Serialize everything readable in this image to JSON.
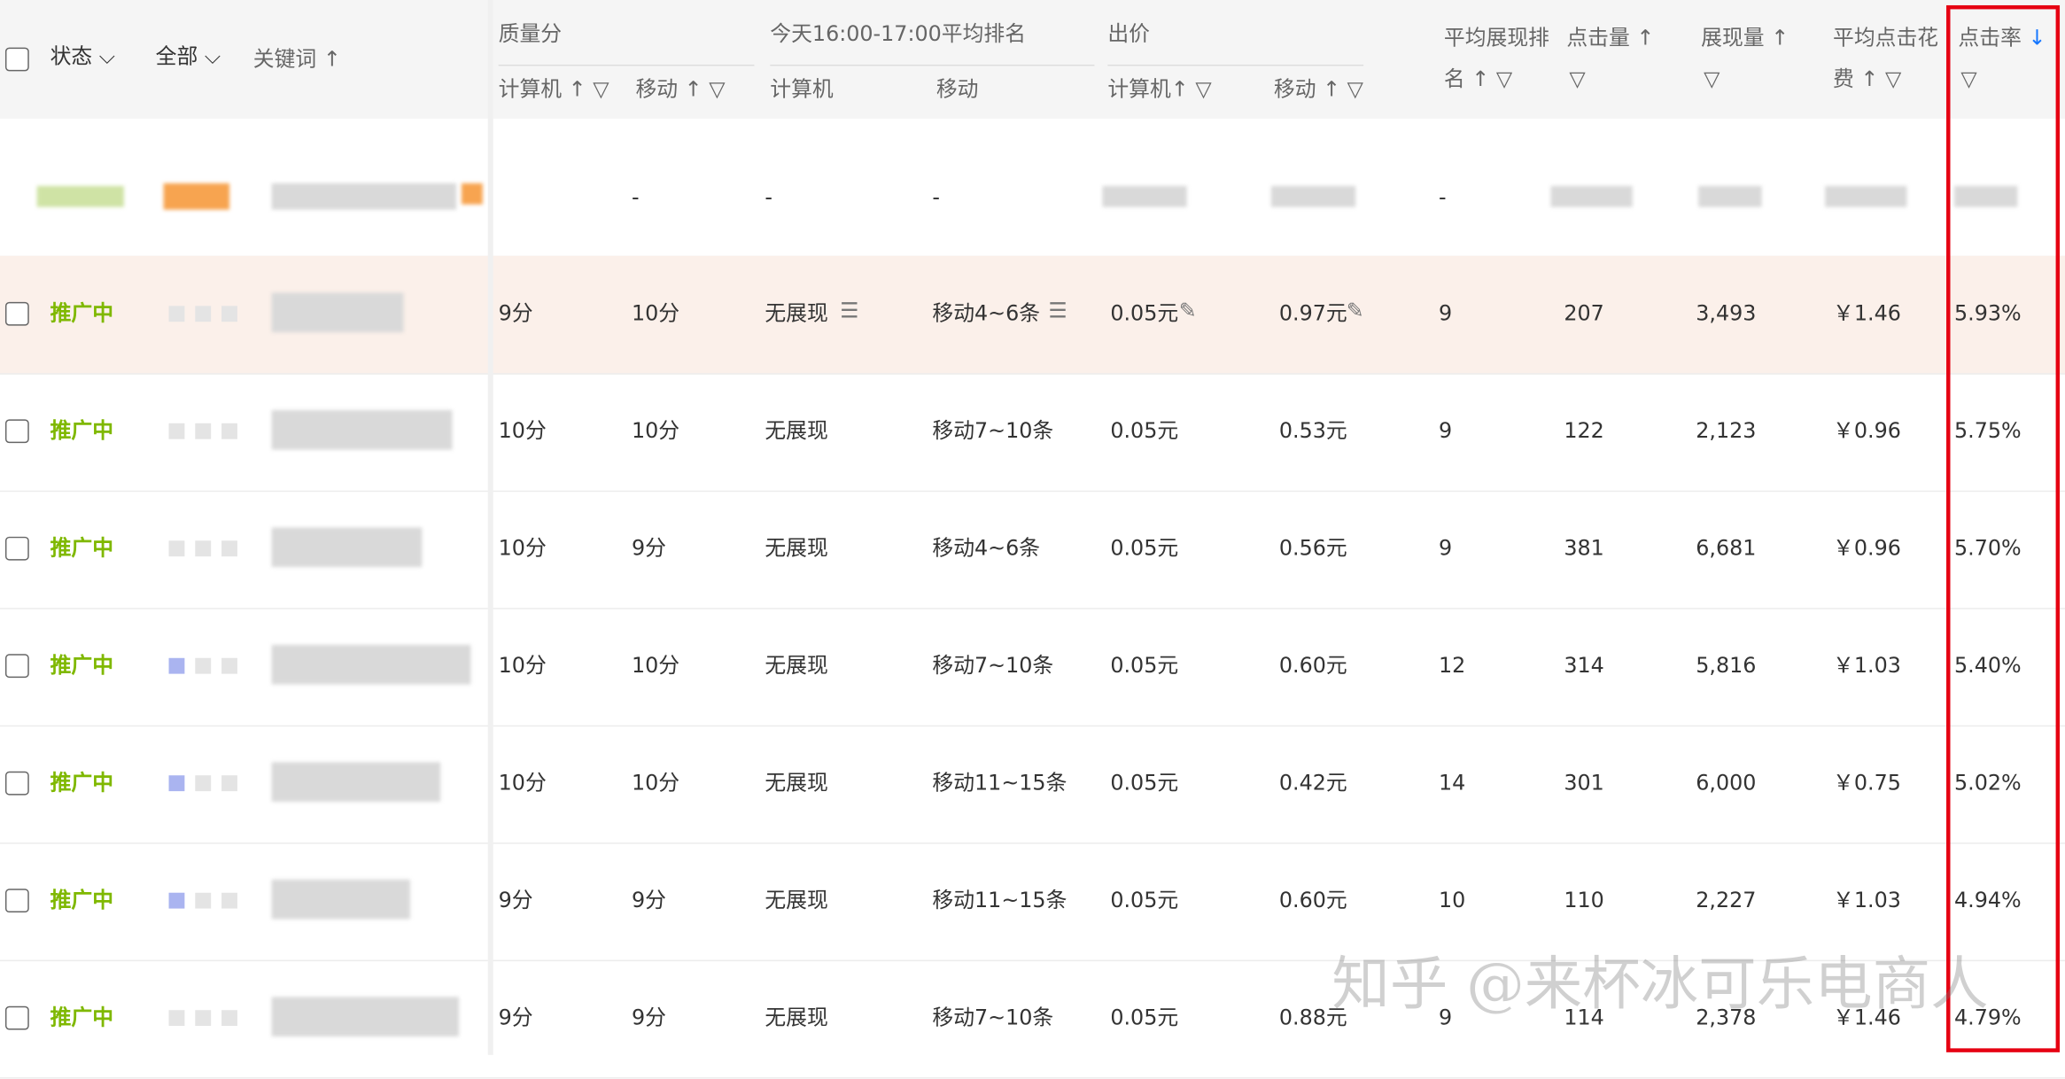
{
  "header": {
    "status": "状态",
    "all": "全部",
    "keyword": "关键词 ↑",
    "quality": "质量分",
    "quality_pc": "计算机 ↑",
    "quality_mobile": "移动 ↑",
    "ranking": "今天16:00-17:00平均排名",
    "ranking_pc": "计算机",
    "ranking_mobile": "移动",
    "bid": "出价",
    "bid_pc": "计算机↑",
    "bid_mobile": "移动 ↑",
    "avg_rank_1": "平均展现排",
    "avg_rank_2": "名 ↑",
    "clicks": "点击量 ↑",
    "impressions": "展现量 ↑",
    "avg_cost_1": "平均点击花",
    "avg_cost_2": "费 ↑",
    "ctr": "点击率",
    "ctr_sort": "↓"
  },
  "summary": {
    "q_pc": "-",
    "q_mobile": "-",
    "rank_pc": "-",
    "avg_rank": "-"
  },
  "rows": [
    {
      "status": "推广中",
      "q_pc": "9分",
      "q_mobile": "10分",
      "rank_pc": "无展现",
      "rank_mobile": "移动4~6条",
      "bid_pc": "0.05元",
      "bid_mobile": "0.97元",
      "avg_rank": "9",
      "clicks": "207",
      "impressions": "3,493",
      "avg_cost": "￥1.46",
      "ctr": "5.93%"
    },
    {
      "status": "推广中",
      "q_pc": "10分",
      "q_mobile": "10分",
      "rank_pc": "无展现",
      "rank_mobile": "移动7~10条",
      "bid_pc": "0.05元",
      "bid_mobile": "0.53元",
      "avg_rank": "9",
      "clicks": "122",
      "impressions": "2,123",
      "avg_cost": "￥0.96",
      "ctr": "5.75%"
    },
    {
      "status": "推广中",
      "q_pc": "10分",
      "q_mobile": "9分",
      "rank_pc": "无展现",
      "rank_mobile": "移动4~6条",
      "bid_pc": "0.05元",
      "bid_mobile": "0.56元",
      "avg_rank": "9",
      "clicks": "381",
      "impressions": "6,681",
      "avg_cost": "￥0.96",
      "ctr": "5.70%"
    },
    {
      "status": "推广中",
      "q_pc": "10分",
      "q_mobile": "10分",
      "rank_pc": "无展现",
      "rank_mobile": "移动7~10条",
      "bid_pc": "0.05元",
      "bid_mobile": "0.60元",
      "avg_rank": "12",
      "clicks": "314",
      "impressions": "5,816",
      "avg_cost": "￥1.03",
      "ctr": "5.40%"
    },
    {
      "status": "推广中",
      "q_pc": "10分",
      "q_mobile": "10分",
      "rank_pc": "无展现",
      "rank_mobile": "移动11~15条",
      "bid_pc": "0.05元",
      "bid_mobile": "0.42元",
      "avg_rank": "14",
      "clicks": "301",
      "impressions": "6,000",
      "avg_cost": "￥0.75",
      "ctr": "5.02%"
    },
    {
      "status": "推广中",
      "q_pc": "9分",
      "q_mobile": "9分",
      "rank_pc": "无展现",
      "rank_mobile": "移动11~15条",
      "bid_pc": "0.05元",
      "bid_mobile": "0.60元",
      "avg_rank": "10",
      "clicks": "110",
      "impressions": "2,227",
      "avg_cost": "￥1.03",
      "ctr": "4.94%"
    },
    {
      "status": "推广中",
      "q_pc": "9分",
      "q_mobile": "9分",
      "rank_pc": "无展现",
      "rank_mobile": "移动7~10条",
      "bid_pc": "0.05元",
      "bid_mobile": "0.88元",
      "avg_rank": "9",
      "clicks": "114",
      "impressions": "2,378",
      "avg_cost": "￥1.46",
      "ctr": "4.79%"
    }
  ],
  "watermark": "知乎 @来杯冰可乐电商人",
  "colors": {
    "status": "#7fb800",
    "highlight": "#e60012",
    "sort_active": "#1677ff"
  }
}
